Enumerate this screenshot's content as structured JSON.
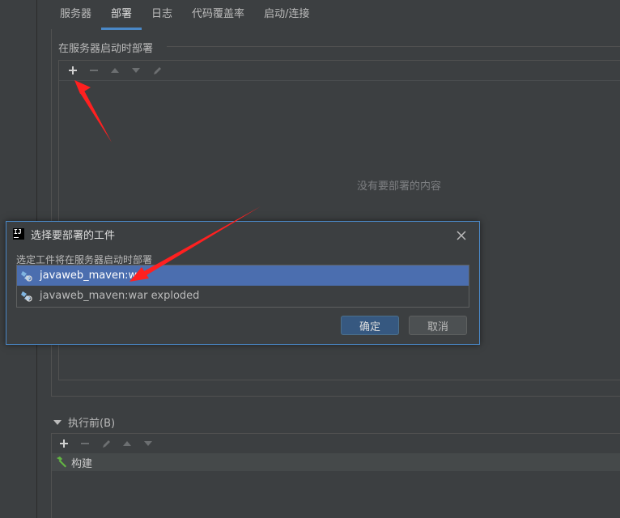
{
  "tabs": [
    {
      "label": "服务器"
    },
    {
      "label": "部署"
    },
    {
      "label": "日志"
    },
    {
      "label": "代码覆盖率"
    },
    {
      "label": "启动/连接"
    }
  ],
  "deploy": {
    "group_title": "在服务器启动时部署",
    "empty_text": "没有要部署的内容"
  },
  "before_launch": {
    "title": "执行前(B)",
    "item": "构建"
  },
  "dialog": {
    "logo": "IJ",
    "title": "选择要部署的工件",
    "label": "选定工件将在服务器启动时部署",
    "items": [
      {
        "label": "javaweb_maven:war"
      },
      {
        "label": "javaweb_maven:war exploded"
      }
    ],
    "ok_label": "确定",
    "cancel_label": "取消"
  },
  "colors": {
    "accent": "#4a88c7",
    "selection": "#4b6eaf",
    "arrow": "#ff2020"
  }
}
